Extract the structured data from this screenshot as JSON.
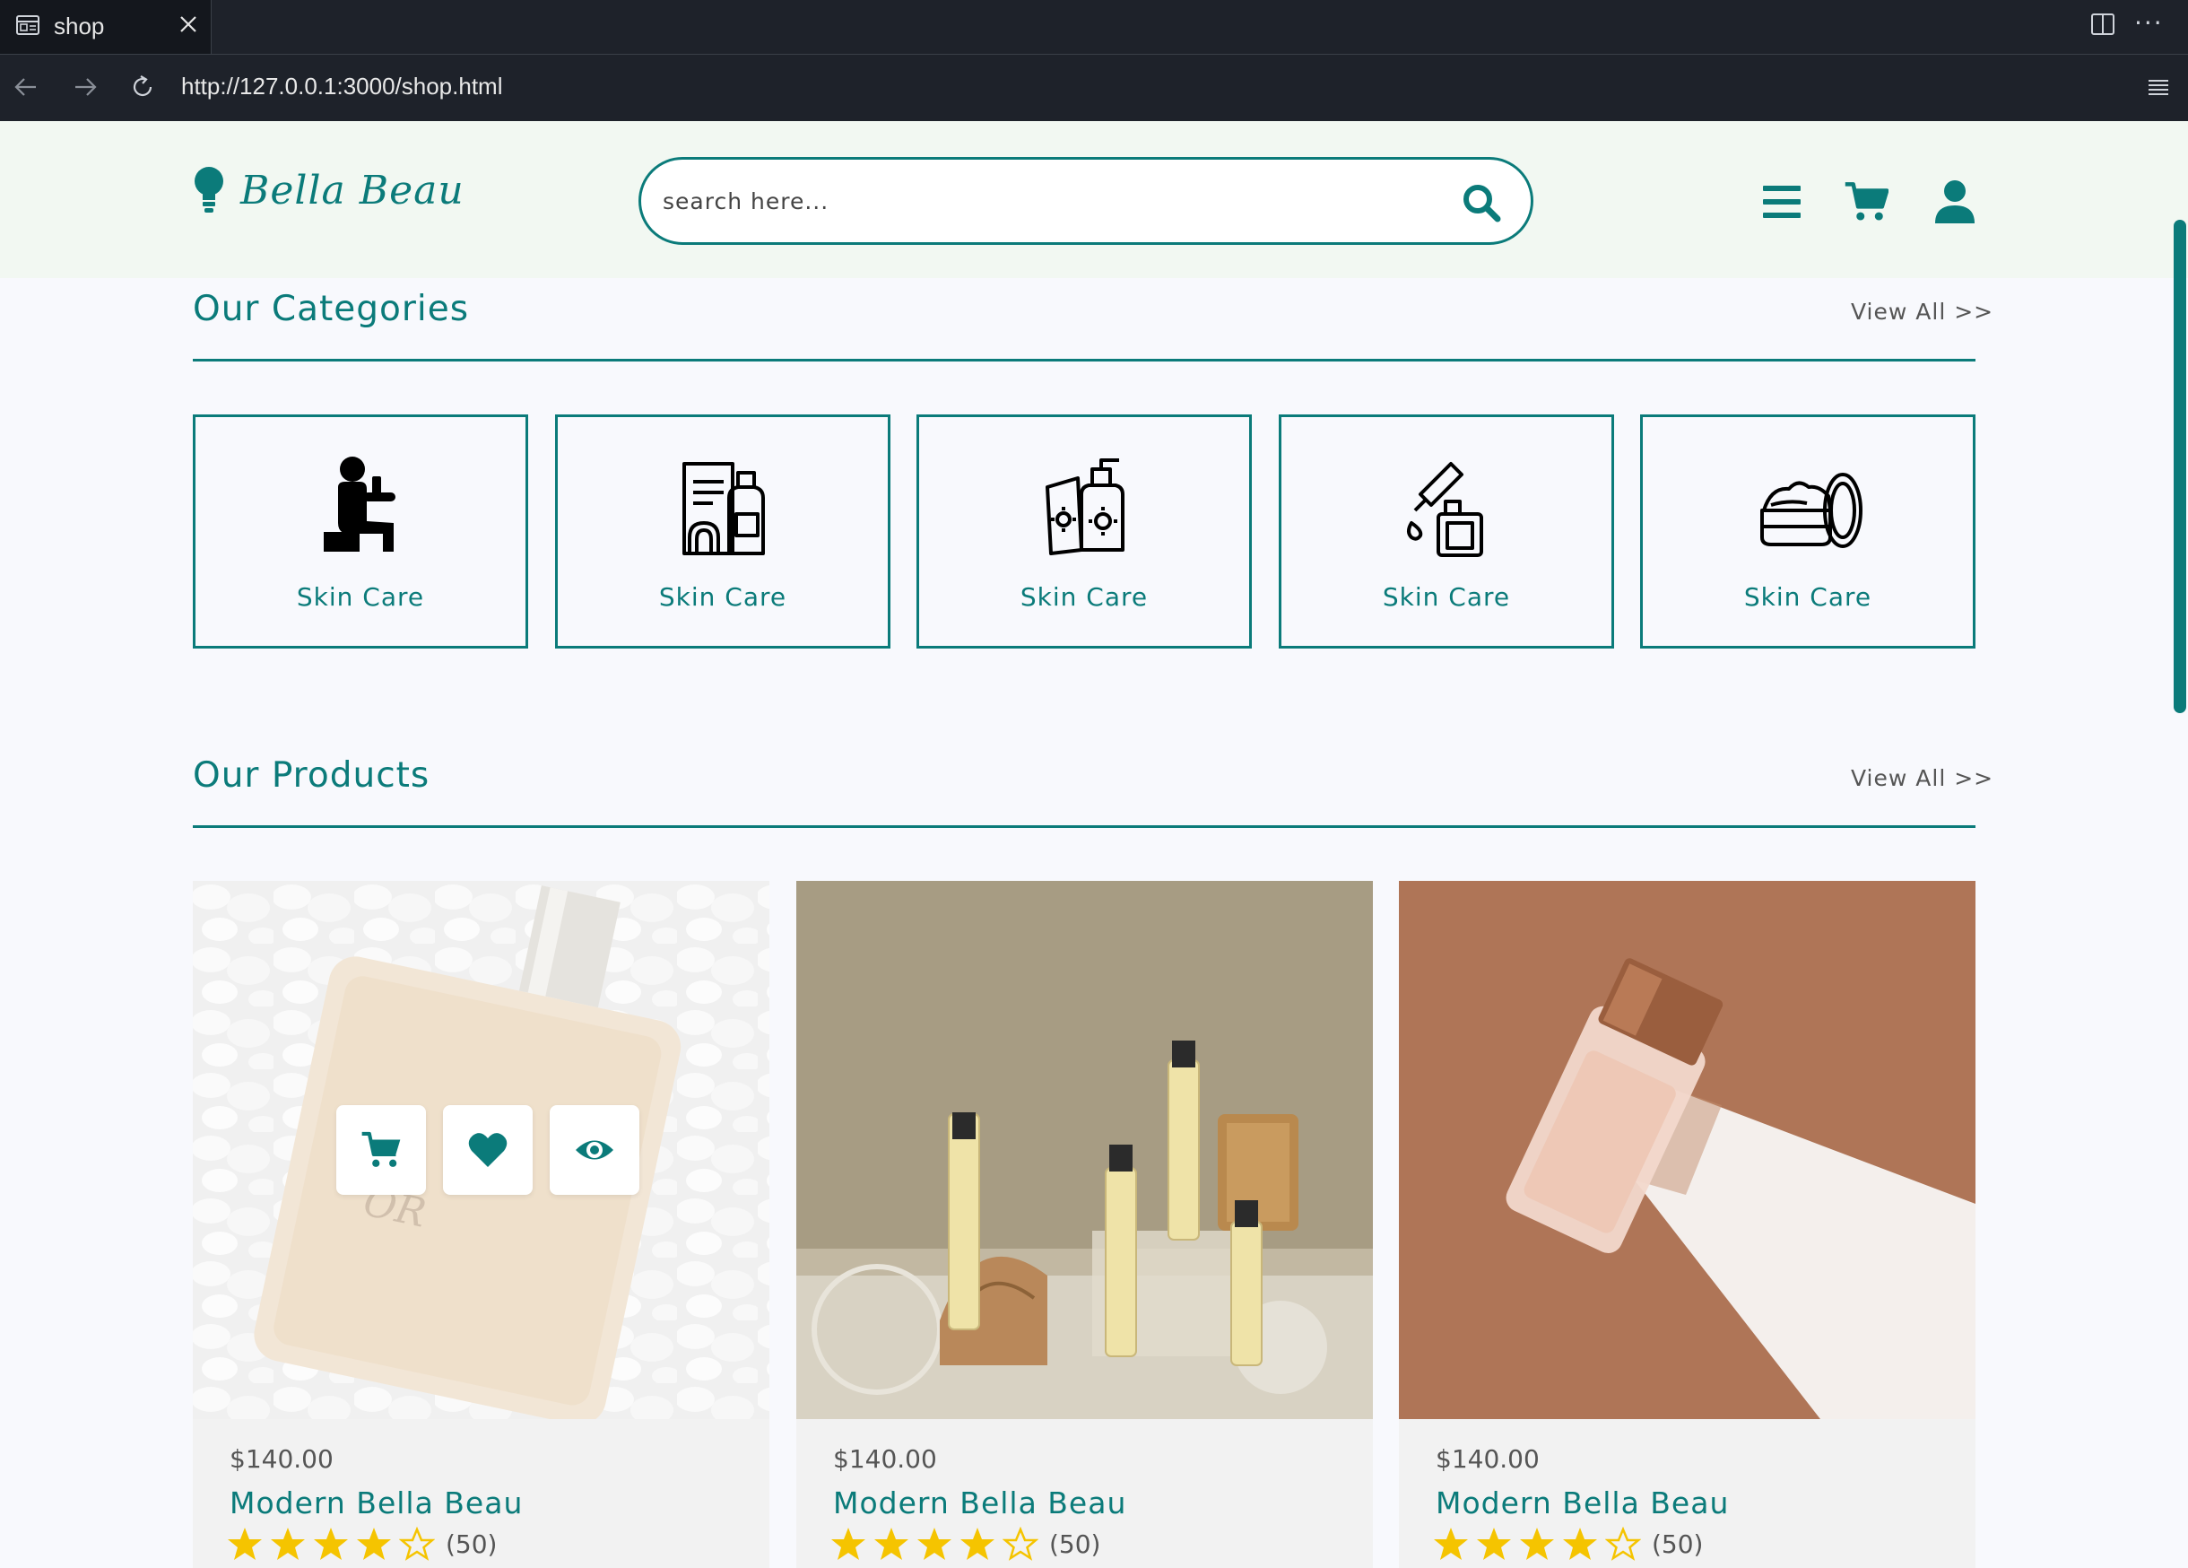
{
  "browser": {
    "tab_title": "shop",
    "url": "http://127.0.0.1:3000/shop.html"
  },
  "header": {
    "logo_text": "Bella Beau",
    "search_placeholder": "search here..."
  },
  "categories": {
    "title": "Our Categories",
    "view_all": "View All >>",
    "items": [
      {
        "label": "Skin Care",
        "icon": "person-applying-lotion-icon"
      },
      {
        "label": "Skin Care",
        "icon": "shampoo-bottles-icon"
      },
      {
        "label": "Skin Care",
        "icon": "sunscreen-tube-icon"
      },
      {
        "label": "Skin Care",
        "icon": "serum-dropper-icon"
      },
      {
        "label": "Skin Care",
        "icon": "cream-jar-icon"
      }
    ]
  },
  "products": {
    "title": "Our Products",
    "view_all": "View All >>",
    "items": [
      {
        "price": "$140.00",
        "name": "Modern Bella Beau",
        "rating": 4,
        "rating_max": 5,
        "reviews": "(50)"
      },
      {
        "price": "$140.00",
        "name": "Modern Bella Beau",
        "rating": 4,
        "rating_max": 5,
        "reviews": "(50)"
      },
      {
        "price": "$140.00",
        "name": "Modern Bella Beau",
        "rating": 4,
        "rating_max": 5,
        "reviews": "(50)"
      }
    ]
  },
  "colors": {
    "brand": "#0b7b7a",
    "star": "#f5c400",
    "header_bg": "#f2f8f2",
    "page_bg": "#f8f9fd"
  }
}
